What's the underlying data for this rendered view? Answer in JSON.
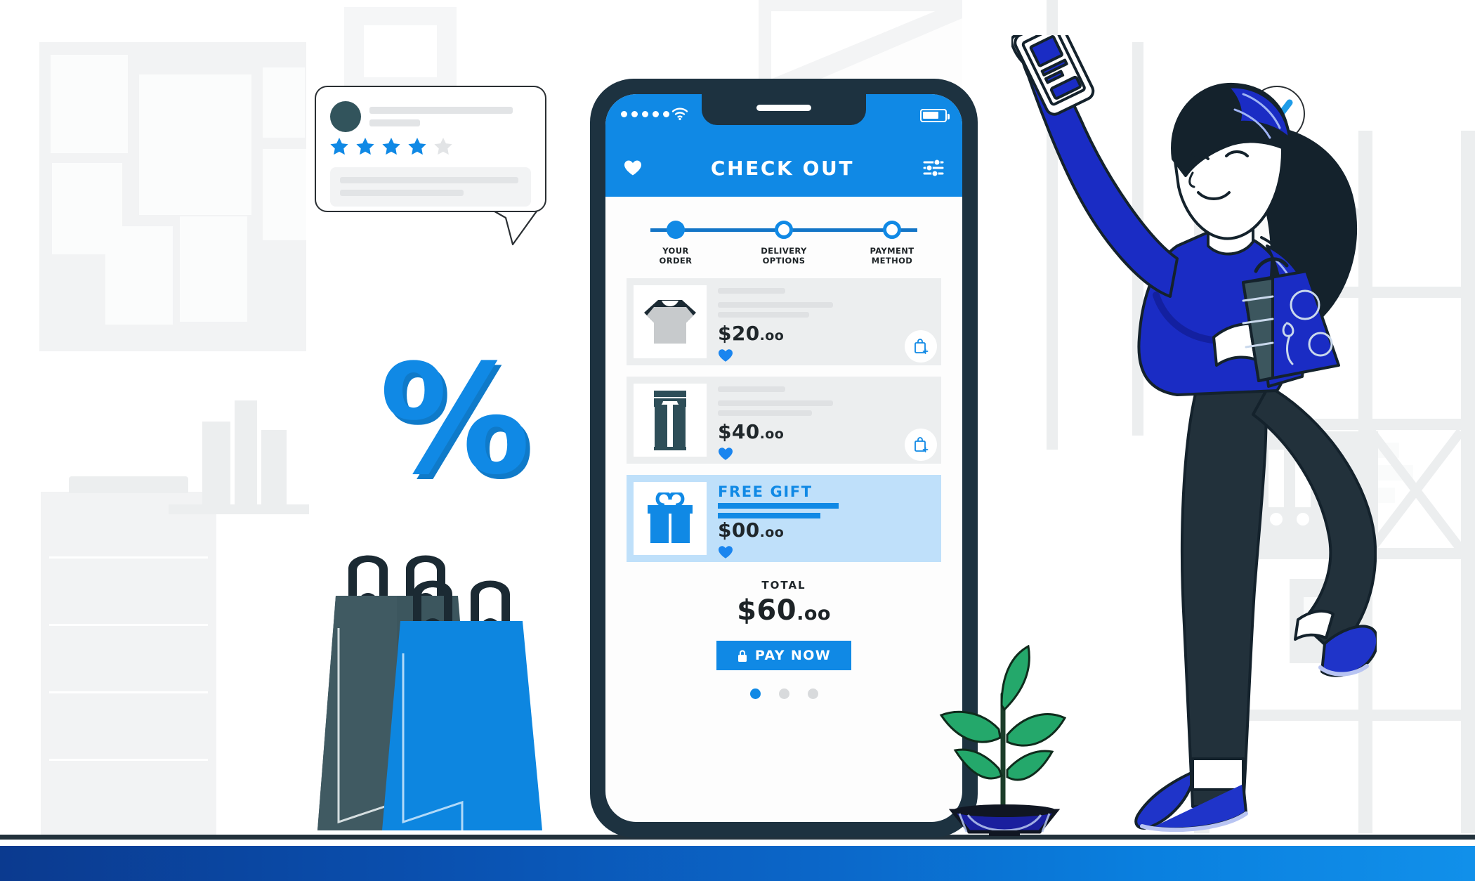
{
  "scene": {
    "title": "Shopping checkout illustration",
    "accent_blue": "#1089e5",
    "deep_blue": "#1a2cc4",
    "dark_navy": "#1d3240",
    "card_gray": "#eceeef",
    "gift_card_blue": "#bfe0fa",
    "bottom_bar_gradient_from": "#0b3a8f",
    "bottom_bar_gradient_to": "#1190ea",
    "plant_green": "#24a86b",
    "pot_blue": "#1a1f9e"
  },
  "phone": {
    "status_bar": {
      "signal_dots": 5,
      "wifi_icon": "wifi-icon",
      "battery_icon": "battery-icon"
    },
    "app_bar": {
      "heart_icon": "heart-icon",
      "title": "CHECK OUT",
      "settings_icon": "sliders-icon"
    },
    "stepper": {
      "steps": [
        {
          "label": "YOUR\nORDER",
          "state": "active"
        },
        {
          "label": "DELIVERY\nOPTIONS",
          "state": "pending"
        },
        {
          "label": "PAYMENT\nMETHOD",
          "state": "pending"
        }
      ]
    },
    "cards": [
      {
        "product_icon": "tshirt-icon",
        "title": "",
        "price": "$20",
        "cents": ".oo",
        "heart_icon": "heart-icon",
        "add_icon": "add-to-bag-icon",
        "highlight": false
      },
      {
        "product_icon": "jeans-icon",
        "title": "",
        "price": "$40",
        "cents": ".oo",
        "heart_icon": "heart-icon",
        "add_icon": "add-to-bag-icon",
        "highlight": false
      },
      {
        "product_icon": "gift-icon",
        "title": "FREE GIFT",
        "price": "$00",
        "cents": ".oo",
        "heart_icon": "heart-icon",
        "add_icon": "",
        "highlight": true
      }
    ],
    "totals": {
      "label": "TOTAL",
      "amount": "$60",
      "cents": ".oo",
      "pay_button": {
        "label": "PAY NOW",
        "icon": "lock-icon"
      }
    },
    "pager": {
      "count": 3,
      "active_index": 0
    }
  },
  "review_bubble": {
    "avatar_icon": "avatar-icon",
    "stars_filled": 4,
    "stars_total": 5,
    "name_placeholder": "",
    "subtitle_placeholder": "",
    "body_placeholder": ""
  },
  "decorations": {
    "percent_symbol": "%",
    "shopping_bags": [
      {
        "name": "dark-shopping-bag",
        "color": "#3c565e"
      },
      {
        "name": "blue-shopping-bag",
        "color": "#0d86e0"
      }
    ],
    "check_bubble_icon": "check-icon",
    "character": {
      "name": "shopper-character",
      "shirt_color": "#1a2cc4",
      "pants_color": "#22313b",
      "hair_color": "#14222c",
      "shoe_color": "#1f34c9",
      "bag_color": "#1a2cc4",
      "holding_icon": "smartphone-icon"
    },
    "plant": {
      "name": "potted-plant",
      "leaf_count": 5
    }
  }
}
